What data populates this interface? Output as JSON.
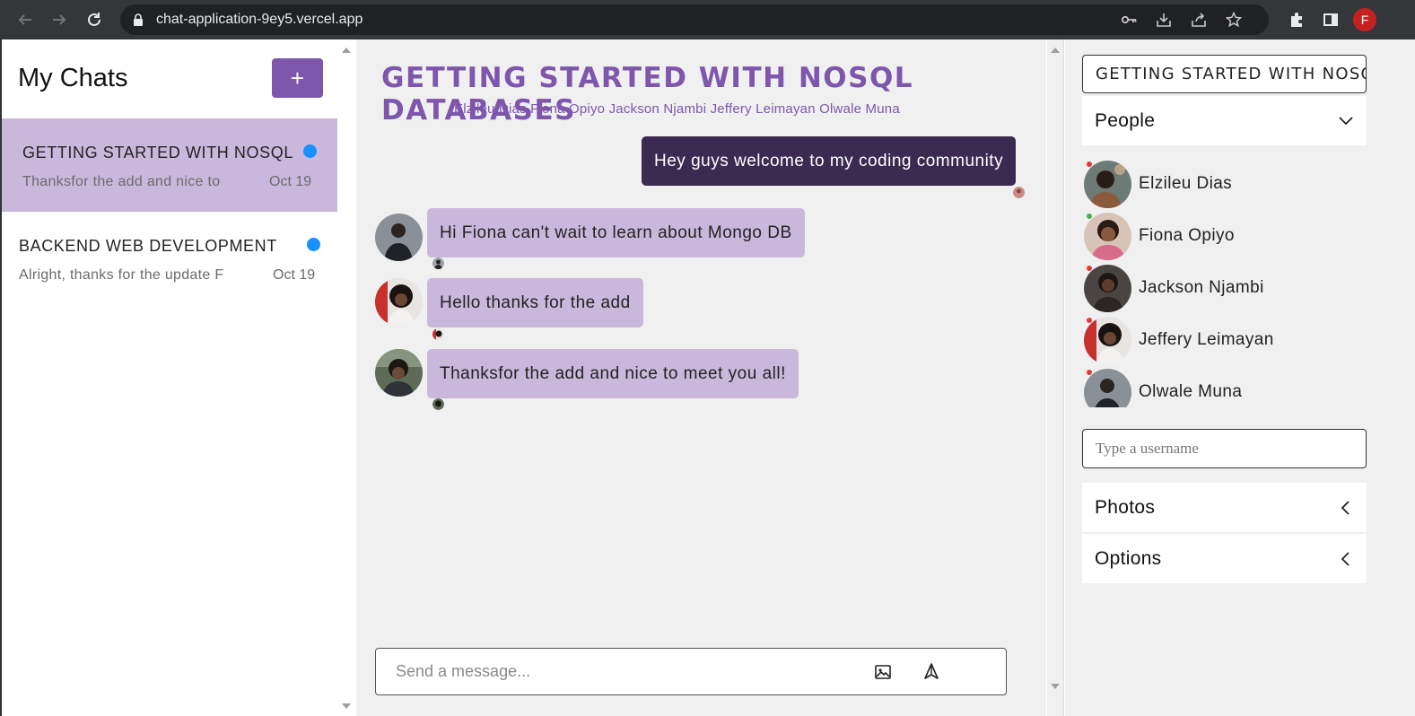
{
  "browser": {
    "url": "chat-application-9ey5.vercel.app",
    "profile_initial": "F"
  },
  "sidebar": {
    "title": "My Chats",
    "new_chat_label": "+",
    "chats": [
      {
        "title": "GETTING STARTED WITH NOSQL",
        "preview": "Thanksfor the add and nice to",
        "date": "Oct 19",
        "unread": true
      },
      {
        "title": "BACKEND WEB DEVELOPMENT",
        "preview": "Alright, thanks for the update F",
        "date": "Oct 19",
        "unread": true
      }
    ]
  },
  "chat": {
    "title": "GETTING STARTED WITH NOSQL DATABASES",
    "members_line": "Elzileu Dias Fiona Opiyo Jackson Njambi Jeffery Leimayan Olwale Muna",
    "messages": [
      {
        "text": "Hey guys welcome to my coding community",
        "mine": true
      },
      {
        "text": "Hi Fiona can't wait to learn about Mongo DB",
        "mine": false
      },
      {
        "text": "Hello thanks for the add",
        "mine": false
      },
      {
        "text": "Thanksfor the add and nice to meet you all!",
        "mine": false
      }
    ],
    "composer_placeholder": "Send a message..."
  },
  "settings": {
    "chat_title_value": "GETTING STARTED WITH NOSQL DATABASES",
    "people_label": "People",
    "people": [
      {
        "name": "Elzileu Dias",
        "online": false
      },
      {
        "name": "Fiona Opiyo",
        "online": true
      },
      {
        "name": "Jackson Njambi",
        "online": false
      },
      {
        "name": "Jeffery Leimayan",
        "online": false
      },
      {
        "name": "Olwale Muna",
        "online": false
      }
    ],
    "username_placeholder": "Type a username",
    "photos_label": "Photos",
    "options_label": "Options"
  },
  "colors": {
    "accent": "#7e57ad",
    "own_bubble": "#3b2a51",
    "other_bubble": "#c9b8dc",
    "unread_dot": "#1890ff",
    "online": "#4caf50",
    "offline": "#e53935"
  }
}
